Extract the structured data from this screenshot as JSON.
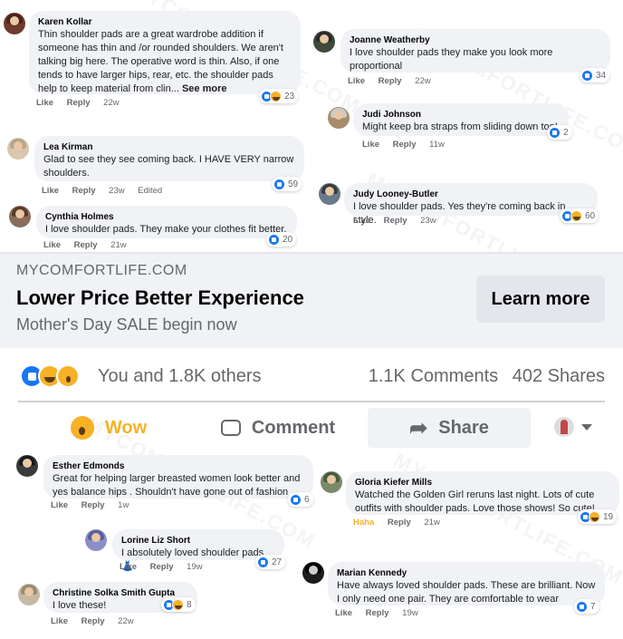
{
  "comments_top_left": [
    {
      "author": "Karen Kollar",
      "text": "Thin shoulder pads are a great wardrobe addition if someone has thin and /or rounded shoulders. We aren't talking big here. The operative word is thin. Also, if one tends to have larger hips, rear, etc. the shoulder pads help to keep material from clin...",
      "see_more": "See more",
      "like": "Like",
      "reply": "Reply",
      "time": "22w",
      "reaction_count": "23"
    },
    {
      "author": "Lea Kirman",
      "text": "Glad to see they see coming back. I HAVE VERY narrow shoulders.",
      "like": "Like",
      "reply": "Reply",
      "time": "23w",
      "edited": "Edited",
      "reaction_count": "59"
    },
    {
      "author": "Cynthia Holmes",
      "text": "I love shoulder pads. They make your clothes fit better.",
      "like": "Like",
      "reply": "Reply",
      "time": "21w",
      "reaction_count": "20"
    }
  ],
  "comments_top_right": [
    {
      "author": "Joanne Weatherby",
      "text": "I love shoulder pads they make you look more proportional",
      "like": "Like",
      "reply": "Reply",
      "time": "22w",
      "reaction_count": "34"
    },
    {
      "author": "Judi Johnson",
      "text": "Might keep bra straps from sliding down too!",
      "like": "Like",
      "reply": "Reply",
      "time": "11w",
      "reaction_count": "2"
    },
    {
      "author": "Judy Looney-Butler",
      "text": "I love shoulder pads. Yes they're coming back in style.",
      "like": "Like",
      "reply": "Reply",
      "time": "23w",
      "reaction_count": "60"
    }
  ],
  "ad": {
    "domain": "MYCOMFORTLIFE.COM",
    "headline": "Lower Price Better Experience",
    "subline": "Mother's Day SALE begin now",
    "cta": "Learn more"
  },
  "summary": {
    "you_and_others": "You and 1.8K others",
    "comments": "1.1K Comments",
    "shares": "402 Shares"
  },
  "actions": {
    "wow": "Wow",
    "comment": "Comment",
    "share": "Share"
  },
  "comments_bottom_left": [
    {
      "author": "Esther Edmonds",
      "text": "Great for helping larger breasted women look better and yes balance hips . Shouldn't have gone out of fashion",
      "like": "Like",
      "reply": "Reply",
      "time": "1w",
      "reaction_count": "6"
    },
    {
      "author": "Lorine Liz Short",
      "text": "I absolutely loved shoulder pads 👗",
      "like": "Like",
      "reply": "Reply",
      "time": "19w",
      "reaction_count": "27"
    },
    {
      "author": "Christine Solka Smith Gupta",
      "text": "I love these!",
      "like": "Like",
      "reply": "Reply",
      "time": "22w",
      "reaction_count": "8"
    }
  ],
  "comments_bottom_right": [
    {
      "author": "Gloria Kiefer Mills",
      "text": "Watched the Golden Girl reruns last night. Lots of cute outfits with shoulder pads. Love those shows! So cute!",
      "haha": "Haha",
      "reply": "Reply",
      "time": "21w",
      "reaction_count": "19"
    },
    {
      "author": "Marian Kennedy",
      "text": "Have always loved shoulder pads. These are brilliant. Now I only need one pair. They are comfortable to wear",
      "like": "Like",
      "reply": "Reply",
      "time": "19w",
      "reaction_count": "7"
    }
  ],
  "watermark": "MYCOMFORTLIFE.COM",
  "colors": {
    "accent": "#1877f2",
    "wow": "#f7b125",
    "muted": "#65676b",
    "bubble": "#f0f2f5"
  }
}
